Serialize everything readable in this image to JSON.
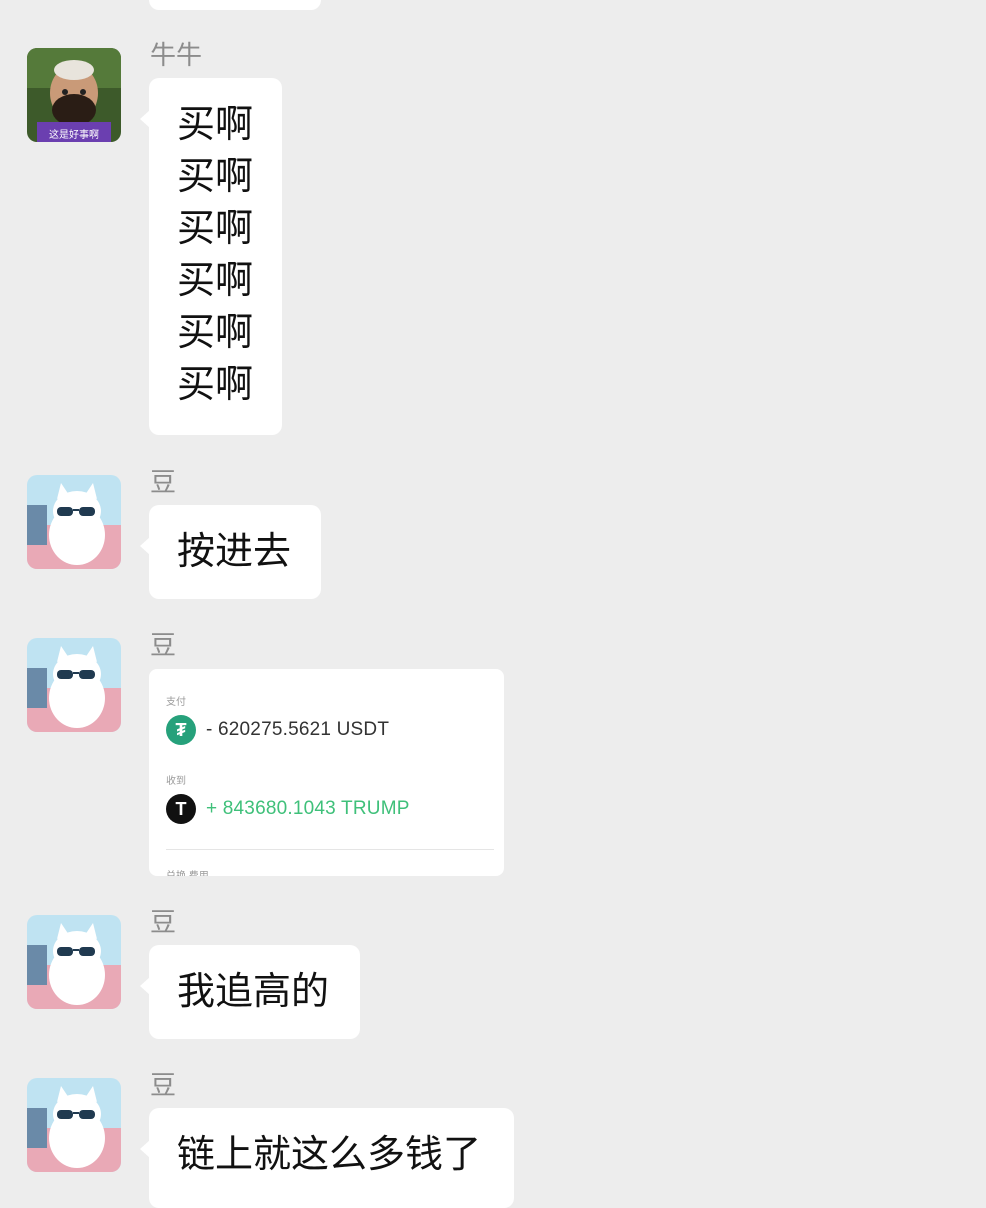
{
  "messages": [
    {
      "sender": "牛牛",
      "lines": [
        "买啊",
        "买啊",
        "买啊",
        "买啊",
        "买啊",
        "买啊"
      ],
      "avatar_caption": "这是好事啊"
    },
    {
      "sender": "豆",
      "text": "按进去"
    },
    {
      "sender": "豆",
      "screenshot": {
        "label_pay": "支付",
        "pay_amount": "- 620275.5621 USDT",
        "pay_icon": "tether-icon",
        "label_receive": "收到",
        "receive_amount": "+ 843680.1043 TRUMP",
        "receive_icon": "trump-token-icon",
        "bottom_label": "兑换 费用",
        "pay_color": "#333333",
        "receive_color": "#3fc07a"
      }
    },
    {
      "sender": "豆",
      "text": "我追高的"
    },
    {
      "sender": "豆",
      "text": "链上就这么多钱了"
    }
  ],
  "colors": {
    "background": "#ededed",
    "bubble": "#ffffff",
    "sender_name": "#8c8c8c",
    "tether_green": "#26a17b"
  }
}
